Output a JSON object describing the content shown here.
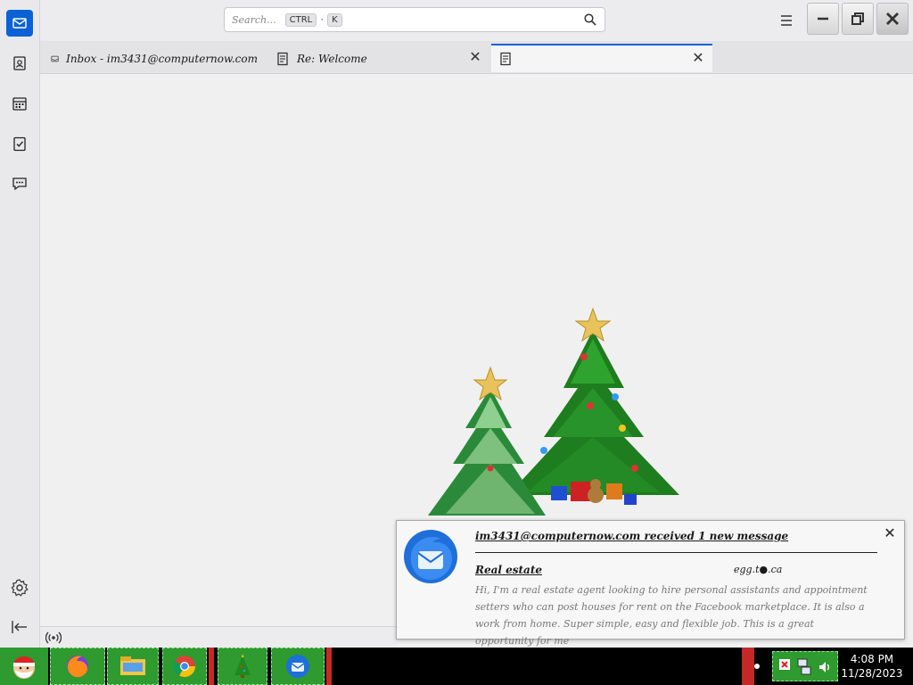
{
  "app": {
    "search_placeholder": "Search...",
    "search_shortcut_mod": "CTRL",
    "search_shortcut_sep": "·",
    "search_shortcut_key": "K"
  },
  "spaces": {
    "items": [
      {
        "name": "mail",
        "icon": "mail-icon",
        "active": true
      },
      {
        "name": "address-book",
        "icon": "address-book-icon",
        "active": false
      },
      {
        "name": "calendar",
        "icon": "calendar-icon",
        "active": false
      },
      {
        "name": "tasks",
        "icon": "tasks-icon",
        "active": false
      },
      {
        "name": "chat",
        "icon": "chat-icon",
        "active": false
      }
    ],
    "bottom": [
      {
        "name": "settings",
        "icon": "gear-icon"
      },
      {
        "name": "collapse",
        "icon": "collapse-sidebar-icon"
      }
    ]
  },
  "tabs": [
    {
      "label": "Inbox - im3431@computernow.com",
      "icon": "inbox-icon",
      "active": false
    },
    {
      "label": "Re: Welcome",
      "icon": "message-icon",
      "active": false
    },
    {
      "label": "",
      "icon": "message-icon",
      "active": true
    }
  ],
  "notification": {
    "title": "im3431@computernow.com received 1 new message",
    "subject": "Real estate",
    "sender": "egg.t●.ca",
    "body": "Hi, I'm a real estate agent looking to hire personal assistants and appointment setters who can post houses for rent on the Facebook marketplace. It is also a work from home. Super simple, easy and flexible job. This is a great opportunity for me"
  },
  "taskbar": {
    "clock_time": "4:08 PM",
    "clock_date": "11/28/2023",
    "apps": [
      "santa-start",
      "firefox",
      "file-explorer",
      "chrome",
      "christmas-tree",
      "thunderbird"
    ]
  },
  "colors": {
    "accent": "#0b62d6",
    "taskbar_green": "#2f9a2f",
    "taskbar_red": "#c62828"
  }
}
